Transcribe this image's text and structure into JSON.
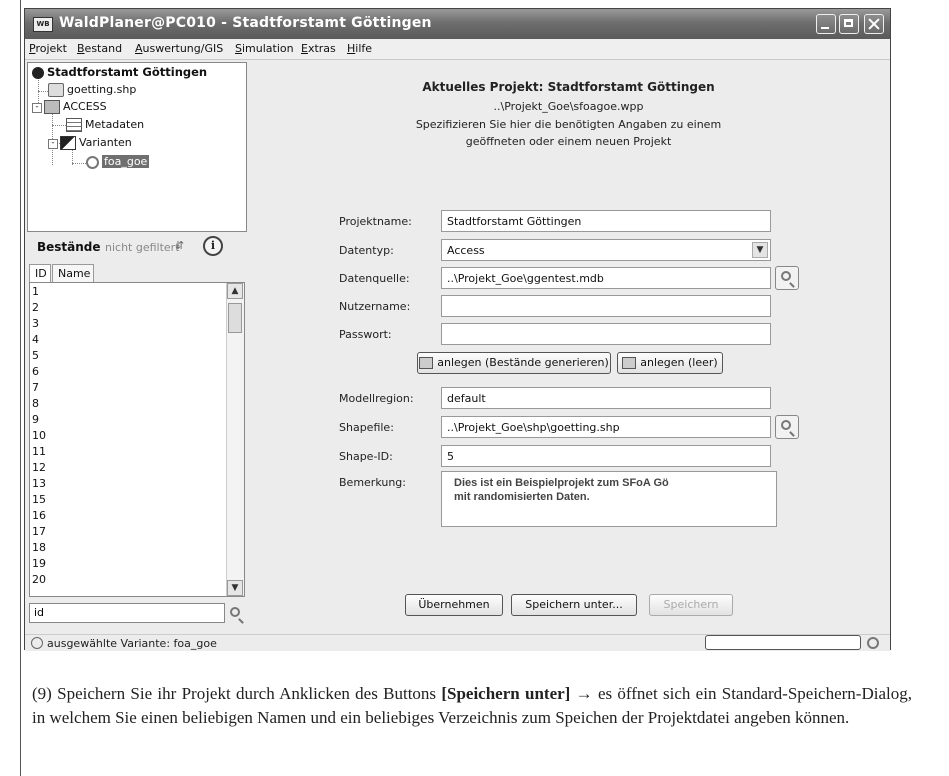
{
  "window": {
    "title": "WaldPlaner@PC010 - Stadtforstamt Göttingen",
    "app_icon_text": "WB"
  },
  "menu": [
    "Projekt",
    "Bestand",
    "Auswertung/GIS",
    "Simulation",
    "Extras",
    "Hilfe"
  ],
  "tree": {
    "root": "Stadtforstamt Göttingen",
    "shapefile": "goetting.shp",
    "access": "ACCESS",
    "metadaten": "Metadaten",
    "varianten": "Varianten",
    "variant_selected": "foa_goe"
  },
  "bestaende": {
    "title": "Bestände",
    "filter_status": "nicht gefiltert",
    "tabs": [
      "ID",
      "Name"
    ],
    "rows": [
      "1",
      "2",
      "3",
      "4",
      "5",
      "6",
      "7",
      "8",
      "9",
      "10",
      "11",
      "12",
      "13",
      "15",
      "16",
      "17",
      "18",
      "19",
      "20"
    ],
    "search_value": "id"
  },
  "header": {
    "title": "Aktuelles Projekt: Stadtforstamt Göttingen",
    "path": "..\\Projekt_Goe\\sfoagoe.wpp",
    "instruction_1": "Spezifizieren Sie hier die benötigten Angaben zu einem",
    "instruction_2": "geöffneten oder einem neuen Projekt"
  },
  "form": {
    "projektname_label": "Projektname:",
    "projektname_value": "Stadtforstamt Göttingen",
    "datentyp_label": "Datentyp:",
    "datentyp_value": "Access",
    "datenquelle_label": "Datenquelle:",
    "datenquelle_value": "..\\Projekt_Goe\\ggentest.mdb",
    "nutzername_label": "Nutzername:",
    "nutzername_value": "",
    "passwort_label": "Passwort:",
    "passwort_value": "",
    "anlegen_bestaende": "anlegen (Bestände generieren)",
    "anlegen_leer": "anlegen (leer)",
    "modellregion_label": "Modellregion:",
    "modellregion_value": "default",
    "shapefile_label": "Shapefile:",
    "shapefile_value": "..\\Projekt_Goe\\shp\\goetting.shp",
    "shapeid_label": "Shape-ID:",
    "shapeid_value": "5",
    "bemerkung_label": "Bemerkung:",
    "bemerkung_line1": "Dies ist ein Beispielprojekt zum SFoA Gö",
    "bemerkung_line2": "mit randomisierten Daten."
  },
  "buttons": {
    "uebernehmen": "Übernehmen",
    "speichern_unter": "Speichern unter...",
    "speichern": "Speichern"
  },
  "status": {
    "text": "ausgewählte Variante: foa_goe"
  },
  "caption": {
    "part1": "(9) Speichern Sie ihr Projekt durch Anklicken des Buttons ",
    "bold": "[Speichern unter]",
    "part2": " → es öffnet sich ein Standard-Speichern-Dialog, in welchem Sie einen beliebigen Namen und ein beliebiges Verzeichnis zum Speichen der Projektdatei angeben können."
  }
}
